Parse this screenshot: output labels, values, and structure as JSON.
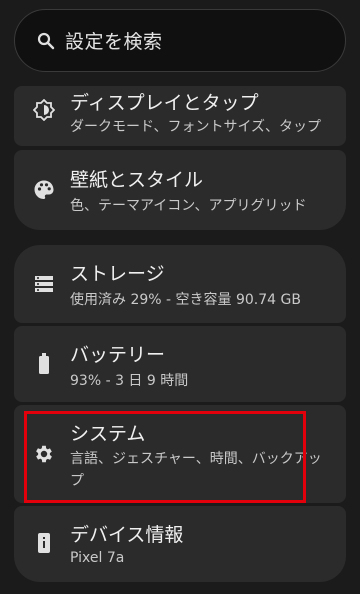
{
  "search": {
    "label": "設定を検索",
    "icon": "search-icon"
  },
  "items": [
    {
      "title": "ディスプレイとタップ",
      "subtitle": "ダークモード、フォントサイズ、タップ",
      "icon": "brightness-icon"
    },
    {
      "title": "壁紙とスタイル",
      "subtitle": "色、テーマアイコン、アプリグリッド",
      "icon": "palette-icon"
    },
    {
      "title": "ストレージ",
      "subtitle": "使用済み 29% - 空き容量 90.74 GB",
      "icon": "storage-icon"
    },
    {
      "title": "バッテリー",
      "subtitle": "93% - 3 日 9 時間",
      "icon": "battery-icon"
    },
    {
      "title": "システム",
      "subtitle": "言語、ジェスチャー、時間、バックアップ",
      "icon": "gear-icon"
    },
    {
      "title": "デバイス情報",
      "subtitle": "Pixel 7a",
      "icon": "device-info-icon"
    }
  ],
  "colors": {
    "background": "#1b1b1b",
    "card": "#2b2b2b",
    "highlight": "#e3000b"
  }
}
